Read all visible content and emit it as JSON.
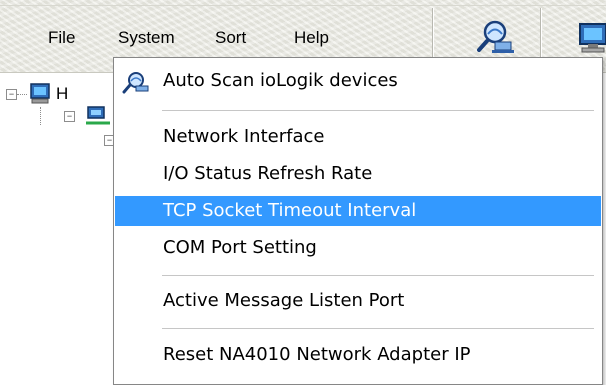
{
  "menubar": {
    "items": [
      {
        "label": "File"
      },
      {
        "label": "System"
      },
      {
        "label": "Sort"
      },
      {
        "label": "Help"
      }
    ],
    "toolbar_icons": [
      "scan-network-icon",
      "computer-icon"
    ]
  },
  "tree": {
    "root_label": "H"
  },
  "system_menu": {
    "items": [
      {
        "label": "Auto Scan ioLogik devices",
        "icon": "scan-network-icon"
      },
      {
        "label": "Network Interface"
      },
      {
        "label": "I/O Status Refresh Rate"
      },
      {
        "label": "TCP Socket Timeout Interval",
        "highlighted": true
      },
      {
        "label": "COM Port Setting"
      },
      {
        "label": "Active Message Listen Port"
      },
      {
        "label": "Reset NA4010 Network Adapter IP"
      }
    ]
  },
  "colors": {
    "highlight": "#3399ff",
    "menubar_bg": "#ecece4"
  }
}
